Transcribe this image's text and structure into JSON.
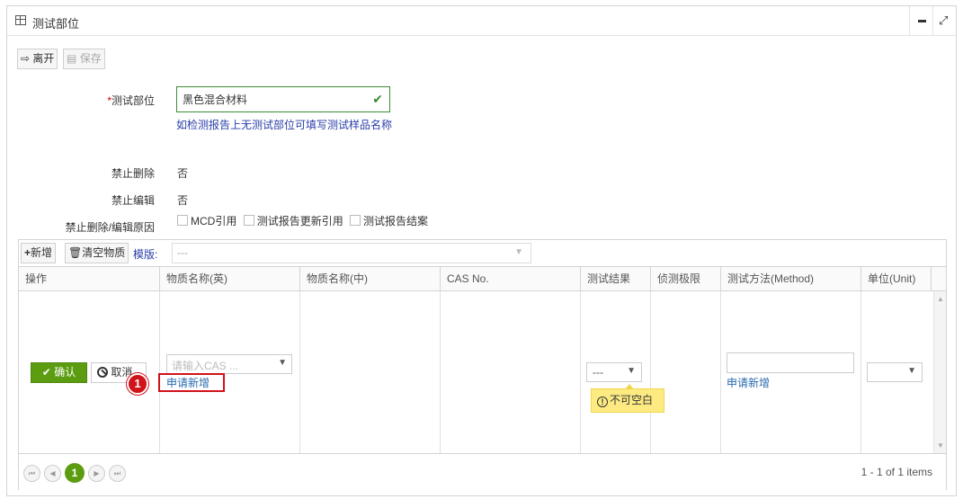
{
  "window": {
    "title": "测试部位",
    "minimize_icon": "minimize-icon",
    "maximize_icon": "maximize-icon"
  },
  "toolbar": {
    "leave_label": "离开",
    "save_label": "保存"
  },
  "form": {
    "position_label": "测试部位",
    "position_required_mark": "*",
    "position_value": "黑色混合材料",
    "position_hint": "如检测报告上无测试部位可填写测试样品名称",
    "no_delete_label": "禁止删除",
    "no_delete_value": "否",
    "no_edit_label": "禁止编辑",
    "no_edit_value": "否",
    "reason_label": "禁止删除/编辑原因",
    "reason_options": [
      "MCD引用",
      "测试报告更新引用",
      "测试报告结案"
    ]
  },
  "grid": {
    "add_label": "新增",
    "clear_label": "清空物质",
    "template_label": "模版:",
    "template_value": "---",
    "columns": [
      "操作",
      "物质名称(英)",
      "物质名称(中)",
      "CAS No.",
      "测试结果",
      "侦测极限",
      "测试方法(Method)",
      "单位(Unit)"
    ],
    "row": {
      "confirm_label": "确认",
      "cancel_label": "取消",
      "cas_placeholder": "请输入CAS ...",
      "apply_new_label": "申请新增",
      "result_value": "---",
      "validation_message": "不可空白",
      "method_apply_label": "申请新增"
    },
    "marker_number": "1",
    "pager": {
      "current_page": "1",
      "info": "1 - 1 of 1 items"
    }
  },
  "colors": {
    "accent_green": "#5b9c10",
    "link_blue": "#2a3ea8",
    "highlight_red": "#d0121b",
    "tooltip_yellow": "#fdeb82"
  }
}
